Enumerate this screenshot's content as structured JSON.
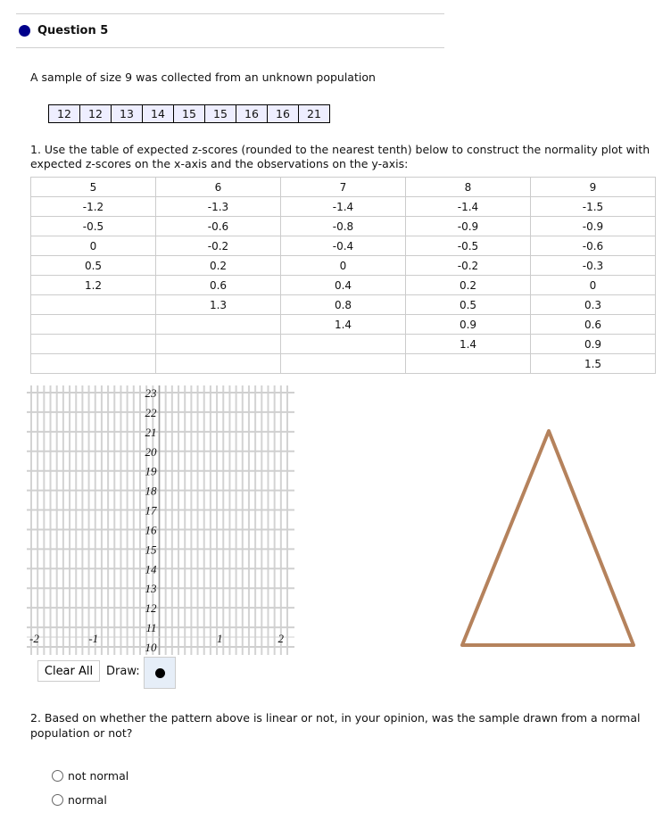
{
  "question": {
    "title": "Question 5",
    "intro": "A sample of size 9 was collected from an unknown population"
  },
  "sample": [
    "12",
    "12",
    "13",
    "14",
    "15",
    "15",
    "16",
    "16",
    "21"
  ],
  "part1": "1. Use the table of expected z-scores (rounded to the nearest tenth) below to construct the normality plot with expected z-scores on the x-axis and the observations on the y-axis:",
  "ztable": {
    "headers": [
      "5",
      "6",
      "7",
      "8",
      "9"
    ],
    "rows": [
      [
        "-1.2",
        "-1.3",
        "-1.4",
        "-1.4",
        "-1.5"
      ],
      [
        "-0.5",
        "-0.6",
        "-0.8",
        "-0.9",
        "-0.9"
      ],
      [
        "0",
        "-0.2",
        "-0.4",
        "-0.5",
        "-0.6"
      ],
      [
        "0.5",
        "0.2",
        "0",
        "-0.2",
        "-0.3"
      ],
      [
        "1.2",
        "0.6",
        "0.4",
        "0.2",
        "0"
      ],
      [
        "",
        "1.3",
        "0.8",
        "0.5",
        "0.3"
      ],
      [
        "",
        "",
        "1.4",
        "0.9",
        "0.6"
      ],
      [
        "",
        "",
        "",
        "1.4",
        "0.9"
      ],
      [
        "",
        "",
        "",
        "",
        "1.5"
      ]
    ]
  },
  "graph": {
    "x_ticks": [
      "-2",
      "-1",
      "1",
      "2"
    ],
    "y_ticks": [
      "10",
      "11",
      "12",
      "13",
      "14",
      "15",
      "16",
      "17",
      "18",
      "19",
      "20",
      "21",
      "22",
      "23"
    ],
    "xlim": [
      -2,
      2
    ],
    "ylim": [
      10,
      23
    ]
  },
  "controls": {
    "clear_all": "Clear All",
    "draw": "Draw:",
    "draw_tool_icon": "point-icon"
  },
  "triangle_color": "#b5825c",
  "part2": "2. Based on whether the pattern above is linear or not, in your opinion, was the sample drawn from a normal population or not?",
  "options": [
    "not normal",
    "normal"
  ]
}
